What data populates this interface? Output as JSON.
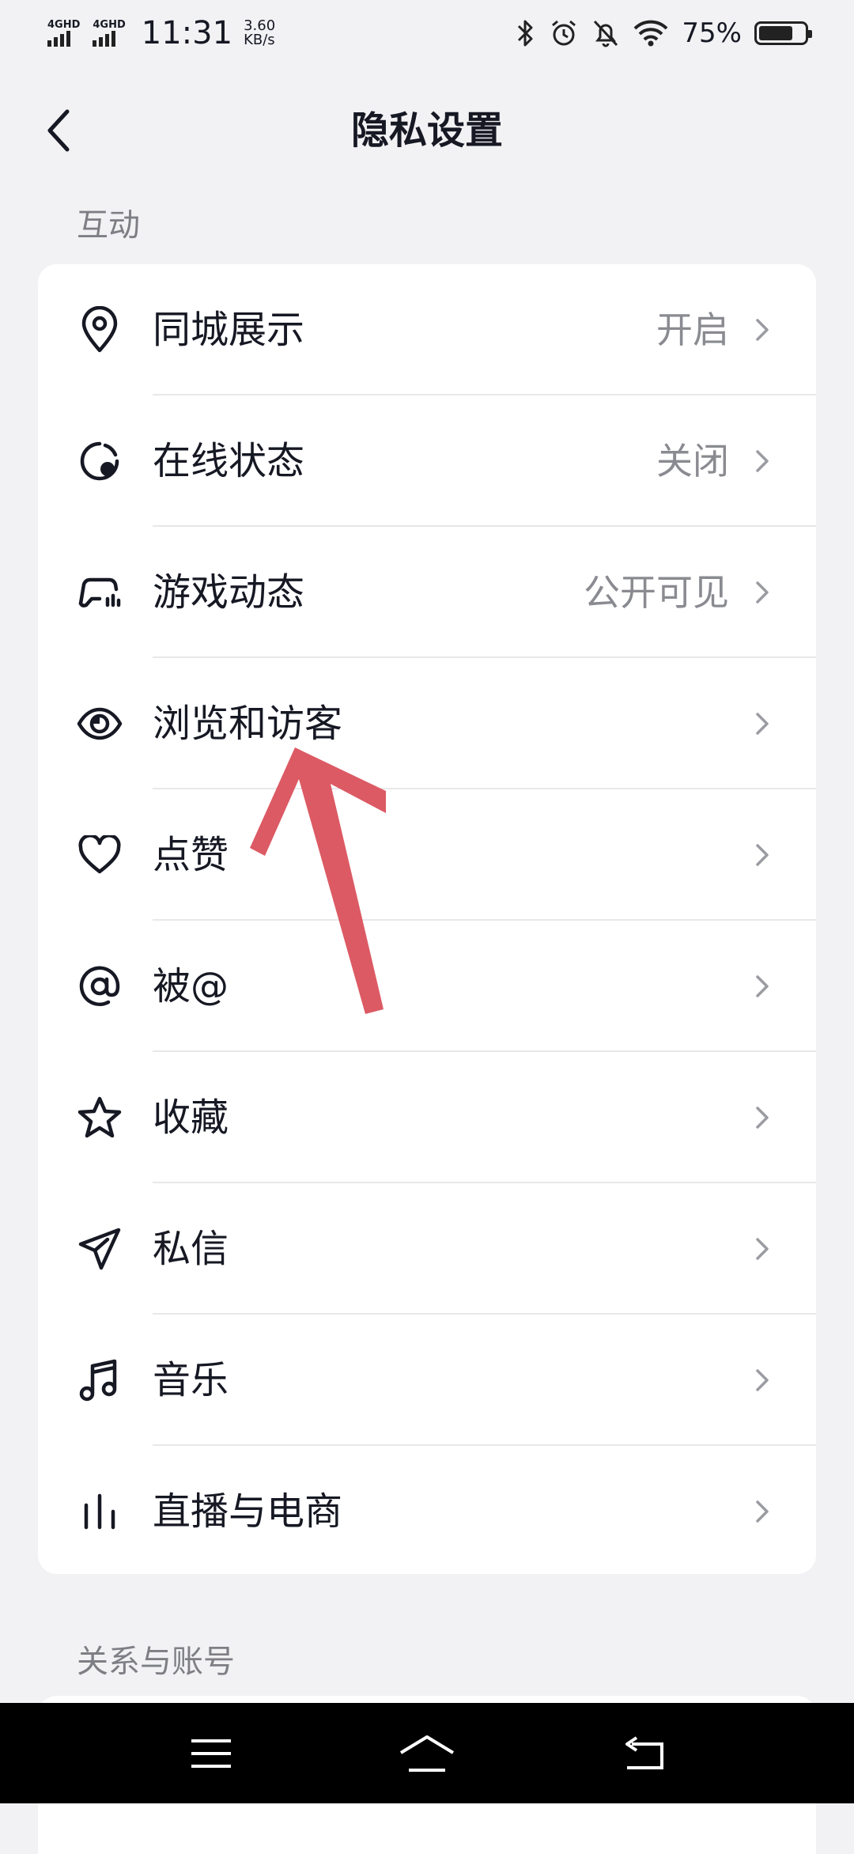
{
  "status_bar": {
    "signal1_label": "4GHD",
    "signal2_label": "4GHD",
    "time": "11:31",
    "net_speed_value": "3.60",
    "net_speed_unit": "KB/s",
    "battery_percent_text": "75%",
    "battery_level": 0.75,
    "icons": [
      "bluetooth-icon",
      "alarm-icon",
      "bell-off-icon",
      "wifi-icon",
      "battery-icon"
    ]
  },
  "header": {
    "title": "隐私设置",
    "back_icon": "chevron-left-icon"
  },
  "sections": [
    {
      "title": "互动",
      "items": [
        {
          "label": "同城展示",
          "value": "开启",
          "icon": "location-pin-icon"
        },
        {
          "label": "在线状态",
          "value": "关闭",
          "icon": "online-status-icon"
        },
        {
          "label": "游戏动态",
          "value": "公开可见",
          "icon": "game-controller-icon"
        },
        {
          "label": "浏览和访客",
          "value": "",
          "icon": "eye-icon"
        },
        {
          "label": "点赞",
          "value": "",
          "icon": "heart-icon"
        },
        {
          "label": "被@",
          "value": "",
          "icon": "at-sign-icon"
        },
        {
          "label": "收藏",
          "value": "",
          "icon": "star-icon"
        },
        {
          "label": "私信",
          "value": "",
          "icon": "send-icon"
        },
        {
          "label": "音乐",
          "value": "",
          "icon": "music-note-icon"
        },
        {
          "label": "直播与电商",
          "value": "",
          "icon": "live-bars-icon"
        }
      ]
    },
    {
      "title": "关系与账号",
      "items": []
    }
  ],
  "annotation": {
    "type": "arrow",
    "color": "#dc5a64",
    "points_to": "浏览和访客"
  },
  "bottom_nav": {
    "icons": [
      "menu-icon",
      "home-icon",
      "back-icon"
    ]
  },
  "colors": {
    "background": "#f2f2f4",
    "card": "#ffffff",
    "text": "#161823",
    "secondary_text": "#8a8b91",
    "arrow": "#dc5a64"
  }
}
